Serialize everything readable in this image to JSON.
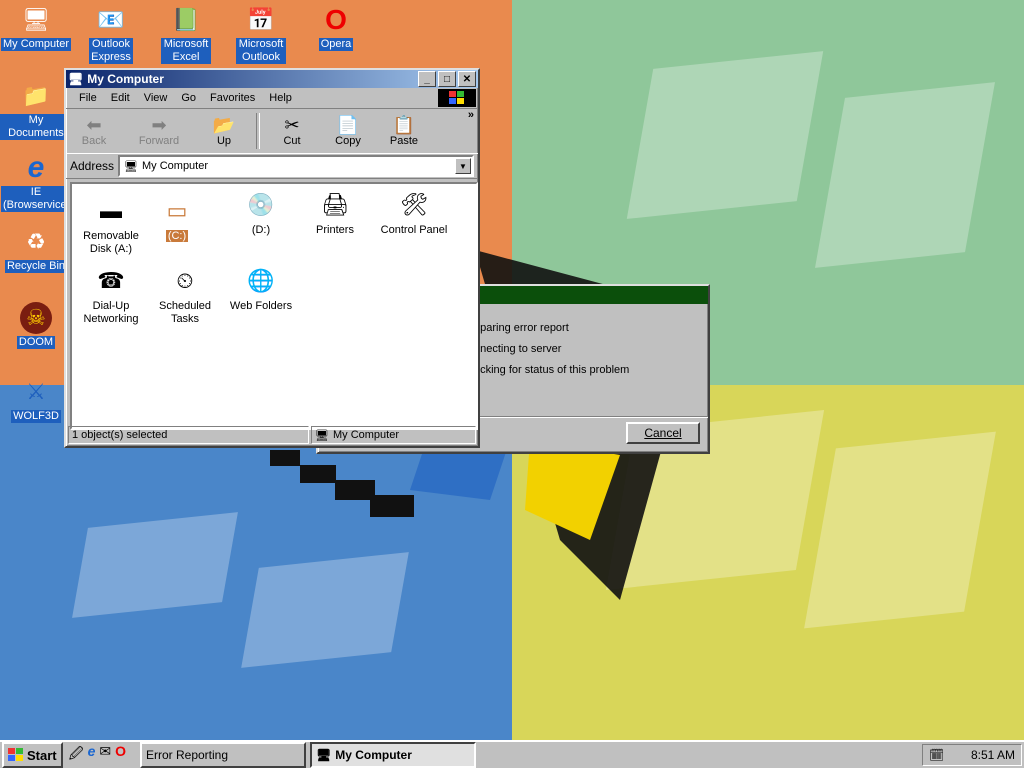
{
  "desktop": {
    "icons": [
      {
        "label": "My Computer",
        "glyph": "🖥"
      },
      {
        "label": "Outlook Express",
        "glyph": "📧"
      },
      {
        "label": "Microsoft Excel",
        "glyph": "📗"
      },
      {
        "label": "Microsoft Outlook",
        "glyph": "📅"
      },
      {
        "label": "Opera",
        "glyph": "O"
      },
      {
        "label": "My Documents",
        "glyph": "📁"
      },
      {
        "label": "IE (Browservice)",
        "glyph": "e"
      },
      {
        "label": "Recycle Bin",
        "glyph": "♻"
      },
      {
        "label": "DOOM",
        "glyph": "☠"
      },
      {
        "label": "WOLF3D",
        "glyph": "⚔"
      }
    ]
  },
  "explorer": {
    "title": "My Computer",
    "menu": [
      "File",
      "Edit",
      "View",
      "Go",
      "Favorites",
      "Help"
    ],
    "toolbar": {
      "back": "Back",
      "forward": "Forward",
      "up": "Up",
      "cut": "Cut",
      "copy": "Copy",
      "paste": "Paste",
      "more": "»"
    },
    "address_label": "Address",
    "address_value": "My Computer",
    "items": [
      {
        "label": "Removable Disk (A:)",
        "glyph": "▬"
      },
      {
        "label": "(C:)",
        "glyph": "▭"
      },
      {
        "label": "(D:)",
        "glyph": "💿"
      },
      {
        "label": "Printers",
        "glyph": "🖨"
      },
      {
        "label": "Control Panel",
        "glyph": "🛠"
      },
      {
        "label": "Dial-Up Networking",
        "glyph": "☎"
      },
      {
        "label": "Scheduled Tasks",
        "glyph": "⏲"
      },
      {
        "label": "Web Folders",
        "glyph": "🌐"
      }
    ],
    "status_left": "1 object(s) selected",
    "status_right": "My Computer"
  },
  "error_dialog": {
    "lines": [
      "eparing error report",
      "nnecting to server",
      "ecking for status of this problem"
    ],
    "cancel": "Cancel"
  },
  "taskbar": {
    "start": "Start",
    "tasks": [
      "Error Reporting",
      "My Computer"
    ],
    "clock": "8:51 AM"
  },
  "colors": {
    "title_active": "#0a246a",
    "dialog_title": "#0b4f0b",
    "desktop_label_bg": "#1e5fbd"
  }
}
